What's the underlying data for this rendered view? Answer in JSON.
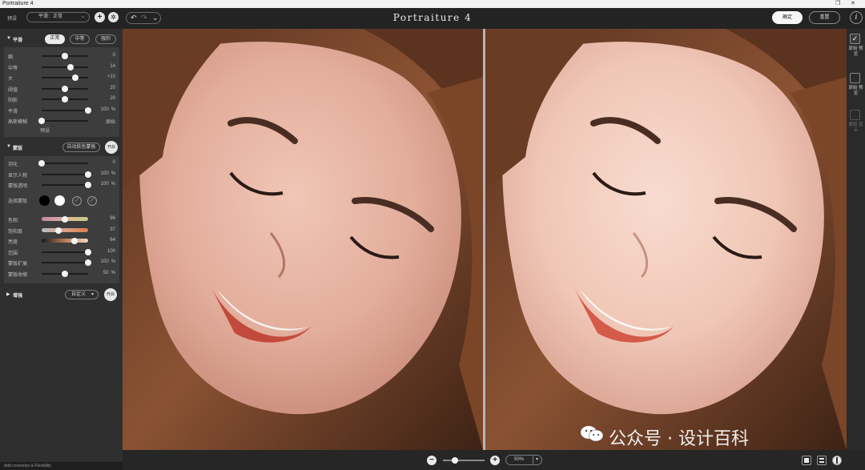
{
  "window": {
    "title": "Portraiture 4"
  },
  "toolbar": {
    "preset_label": "预设",
    "preset_value": "平滑：正常",
    "add_symbol": "+",
    "gear_symbol": "✲",
    "undo_symbol": "↶",
    "redo_symbol": "↷",
    "history_symbol": "⌄",
    "app_title": "Portraiture 4",
    "ok_label": "确定",
    "reset_label": "重置",
    "info_symbol": "i"
  },
  "smoothing": {
    "title": "平滑",
    "modes": [
      "正常",
      "中等",
      "强烈"
    ],
    "active_mode": 0,
    "sliders": [
      {
        "label": "细",
        "value": "0",
        "pos": 0.5
      },
      {
        "label": "中等",
        "value": "14",
        "pos": 0.62
      },
      {
        "label": "大",
        "value": "+10",
        "pos": 0.72
      },
      {
        "label": "阈值",
        "value": "20",
        "pos": 0.5
      },
      {
        "label": "阴影",
        "value": "20",
        "pos": 0.5
      },
      {
        "label": "平滑",
        "value": "100",
        "unit": "%",
        "pos": 1.0
      },
      {
        "label": "高斯模糊",
        "value": "原始",
        "pos": 0.0
      }
    ],
    "blur_note": "预设"
  },
  "skin_mask": {
    "title": "蒙版",
    "auto_button": "自动肤色蒙板",
    "toggle_label": "开启",
    "sliders": [
      {
        "label": "羽化",
        "value": "0",
        "pos": 0.0
      },
      {
        "label": "显示人物",
        "value": "100",
        "unit": "%",
        "pos": 1.0
      },
      {
        "label": "蒙版透明",
        "value": "100",
        "unit": "%",
        "pos": 1.0
      }
    ],
    "color_label": "选择蒙版",
    "color_sliders": [
      {
        "label": "色相",
        "value": "96",
        "pos": 0.5,
        "gradient": "linear-gradient(90deg,#c68aa7,#d6a0a0,#d8c08c,#c6c98d)"
      },
      {
        "label": "饱和度",
        "value": "37",
        "pos": 0.37,
        "gradient": "linear-gradient(90deg,#bdbdbd,#d9a184,#e07a4d)"
      },
      {
        "label": "亮度",
        "value": "64",
        "pos": 0.71,
        "gradient": "linear-gradient(90deg,#1a1a1a,#8b5a3e,#d69b7a,#f1d5c4)"
      },
      {
        "label": "范围",
        "value": "100",
        "pos": 1.0
      },
      {
        "label": "蒙版扩展",
        "value": "100",
        "unit": "%",
        "pos": 1.0
      },
      {
        "label": "蒙版收缩",
        "value": "50",
        "unit": "%",
        "pos": 0.5
      }
    ]
  },
  "enhance": {
    "title": "增强",
    "select_value": "自定义",
    "toggle_label": "开启"
  },
  "right_panel": {
    "views": [
      {
        "label": "原始 预览",
        "checked": true
      },
      {
        "label": "原始 预览",
        "checked": false
      },
      {
        "label": "蒙版 显示",
        "checked": false
      }
    ]
  },
  "bottom": {
    "zoom_out": "−",
    "zoom_in": "+",
    "zoom_pos": 0.28,
    "zoom_value": "50%"
  },
  "status": {
    "text": "Add correction & Flexibility"
  },
  "watermark": {
    "text": "公众号 · 设计百科"
  },
  "colors": {
    "panel_bg": "#2f2f2f",
    "box_bg": "#3d3d3d",
    "swatch_dark": "#000000",
    "swatch_light": "#ffffff",
    "hair": "#7a4a2b",
    "skin_before": "#e7b6a4",
    "skin_after": "#f2cdbf"
  }
}
